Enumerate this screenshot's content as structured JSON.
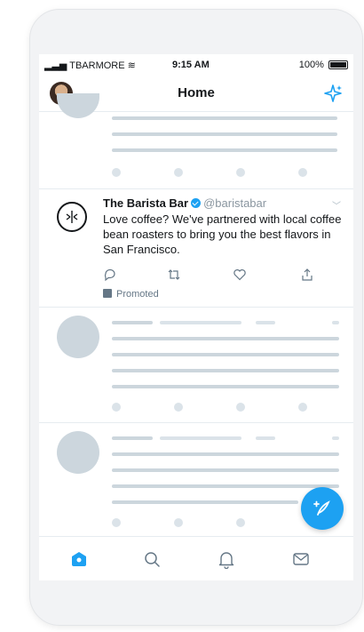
{
  "status_bar": {
    "carrier": "TBARMORE",
    "time": "9:15 AM",
    "battery": "100%"
  },
  "header": {
    "title": "Home",
    "avatar_icon": "profile-avatar",
    "action_icon": "sparkle-icon"
  },
  "promoted_tweet": {
    "name": "The Barista Bar",
    "handle": "@baristabar",
    "text": "Love coffee? We've partnered with local coffee bean roasters to bring you the best flavors in San Francisco.",
    "promoted_label": "Promoted",
    "actions": [
      "reply-icon",
      "retweet-icon",
      "like-icon",
      "share-icon"
    ]
  },
  "tab_bar": {
    "tabs": [
      "home-icon",
      "search-icon",
      "notifications-icon",
      "messages-icon"
    ],
    "active": "home-icon"
  },
  "compose_button": {
    "icon": "compose-tweet-icon"
  },
  "colors": {
    "accent": "#1da1f2",
    "skeleton": "#ccd6dd",
    "text": "#14171a",
    "secondary_text": "#657786"
  }
}
